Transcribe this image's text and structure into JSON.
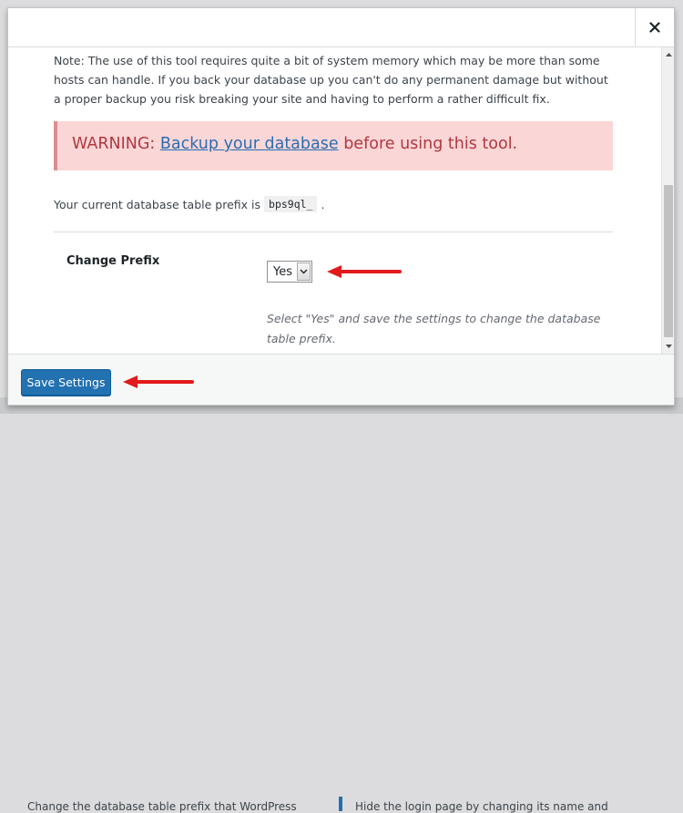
{
  "background": {
    "left_text": "Change the database table prefix that WordPress",
    "right_text": "Hide the login page by changing its name and"
  },
  "header": {
    "close_icon": "close-icon",
    "close_glyph": "✕"
  },
  "content": {
    "note": "Note: The use of this tool requires quite a bit of system memory which may be more than some hosts can handle. If you back your database up you can't do any permanent damage but without a proper backup you risk breaking your site and having to perform a rather difficult fix.",
    "warning": {
      "prefix": "WARNING:",
      "link": "Backup your database",
      "suffix": "before using this tool.",
      "background": "#fbd6d7",
      "text_color": "#b0383f"
    },
    "prefix_label": "Your current database table prefix is",
    "prefix_value": "bps9ql_",
    "prefix_end": ".",
    "change_prefix": {
      "label": "Change Prefix",
      "selected": "Yes",
      "description": "Select \"Yes\" and save the settings to change the database table prefix."
    }
  },
  "footer": {
    "save_label": "Save Settings",
    "accent": "#2271b1"
  },
  "annotations": {
    "arrow_color": "#e21a1a"
  }
}
